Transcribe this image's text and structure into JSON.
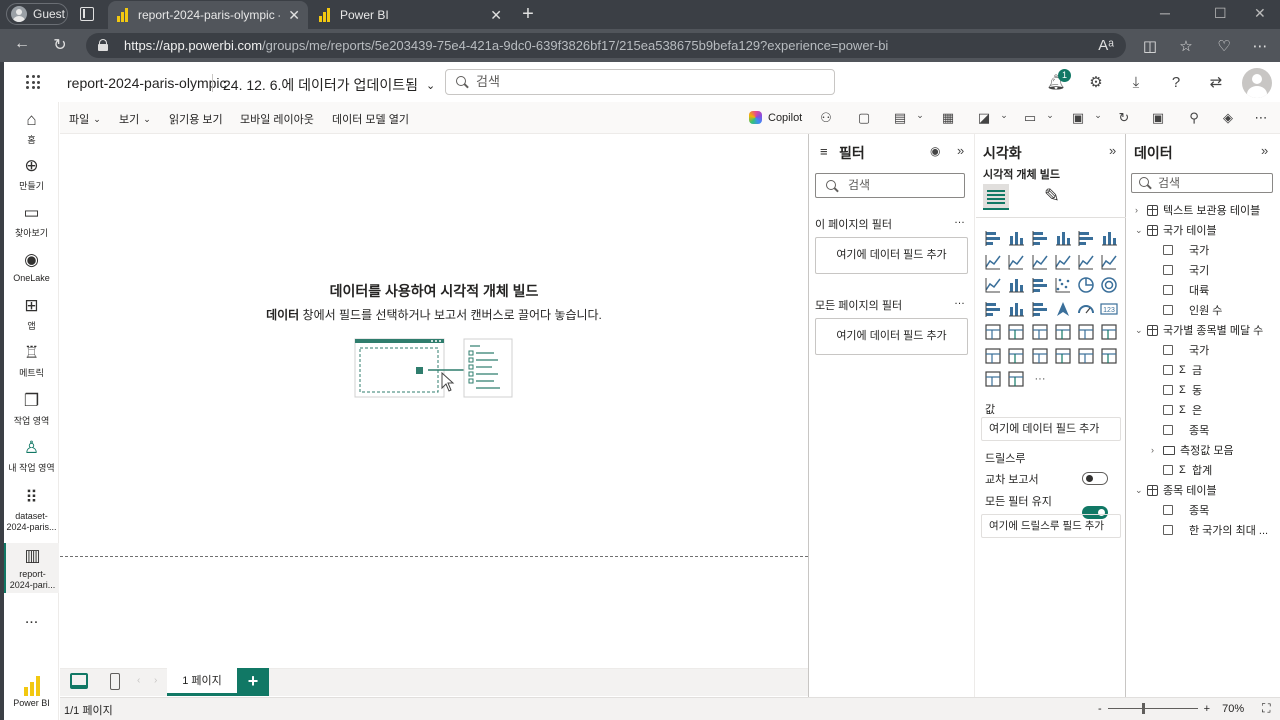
{
  "browser": {
    "profile_label": "Guest",
    "tabs": [
      {
        "title": "report-2024-paris-olympic - Power BI"
      },
      {
        "title": "Power BI"
      }
    ],
    "url_host": "https://app.powerbi.com",
    "url_path": "/groups/me/reports/5e203439-75e4-421a-9dc0-639f3826bf17/215ea538675b9befa129?experience=power-bi"
  },
  "header": {
    "report_name": "report-2024-paris-olympic",
    "updated_text": "24. 12. 6.에 데이터가 업데이트됨",
    "search_placeholder": "검색",
    "notification_count": "1"
  },
  "leftnav": {
    "items": [
      {
        "label": "홈",
        "icon": "home-icon"
      },
      {
        "label": "만들기",
        "icon": "create-icon"
      },
      {
        "label": "찾아보기",
        "icon": "browse-icon"
      },
      {
        "label": "OneLake",
        "icon": "onelake-icon"
      },
      {
        "label": "앱",
        "icon": "apps-icon"
      },
      {
        "label": "메트릭",
        "icon": "metrics-icon"
      },
      {
        "label": "작업 영역",
        "icon": "workspaces-icon"
      },
      {
        "label": "내 작업 영역",
        "icon": "my-workspace-icon"
      },
      {
        "label": "dataset-2024-paris...",
        "icon": "dataset-icon"
      },
      {
        "label": "report-2024-pari...",
        "icon": "report-icon"
      }
    ],
    "more_label": "...",
    "brand_label": "Power BI"
  },
  "ribbon": {
    "menus": [
      {
        "label": "파일"
      },
      {
        "label": "보기"
      },
      {
        "label": "읽기용 보기"
      },
      {
        "label": "모바일 레이아웃"
      },
      {
        "label": "데이터 모델 열기"
      }
    ],
    "copilot_label": "Copilot"
  },
  "canvas": {
    "title": "데이터를 사용하여 시각적 개체 빌드",
    "subtitle_bold": "데이터",
    "subtitle_rest": " 창에서 필드를 선택하거나 보고서 캔버스로 끌어다 놓습니다."
  },
  "pages": {
    "current_tab": "1 페이지",
    "add_label": "+",
    "status": "1/1 페이지",
    "zoom_label": "70%",
    "zoom_level": 0.7
  },
  "filters": {
    "title": "필터",
    "search_placeholder": "검색",
    "this_page_label": "이 페이지의 필터",
    "all_pages_label": "모든 페이지의 필터",
    "dropzone_label": "여기에 데이터 필드 추가"
  },
  "viz": {
    "title": "시각화",
    "subtitle": "시각적 개체 빌드",
    "values_label": "값",
    "values_drop": "여기에 데이터 필드 추가",
    "drill_label": "드릴스루",
    "cross_report_label": "교차 보고서",
    "cross_report_on": false,
    "keep_filters_label": "모든 필터 유지",
    "keep_filters_on": true,
    "drill_drop": "여기에 드릴스루 필드 추가",
    "more_label": "···",
    "accent_color": "#117865"
  },
  "data": {
    "title": "데이터",
    "search_placeholder": "검색",
    "tree": [
      {
        "kind": "table",
        "label": "텍스트 보관용 테이블",
        "expanded": false
      },
      {
        "kind": "table",
        "label": "국가 테이블",
        "expanded": true
      },
      {
        "kind": "field",
        "label": "국가"
      },
      {
        "kind": "field",
        "label": "국기"
      },
      {
        "kind": "field",
        "label": "대륙"
      },
      {
        "kind": "field",
        "label": "인원 수"
      },
      {
        "kind": "table",
        "label": "국가별 종목별 메달 수",
        "expanded": true
      },
      {
        "kind": "field",
        "label": "국가"
      },
      {
        "kind": "measure",
        "label": "금"
      },
      {
        "kind": "measure",
        "label": "동"
      },
      {
        "kind": "measure",
        "label": "은"
      },
      {
        "kind": "field",
        "label": "종목"
      },
      {
        "kind": "folder",
        "label": "측정값 모음"
      },
      {
        "kind": "measure",
        "label": "합계"
      },
      {
        "kind": "table",
        "label": "종목 테이블",
        "expanded": true
      },
      {
        "kind": "field",
        "label": "종목"
      },
      {
        "kind": "field",
        "label": "한 국가의 최대 ..."
      }
    ]
  }
}
